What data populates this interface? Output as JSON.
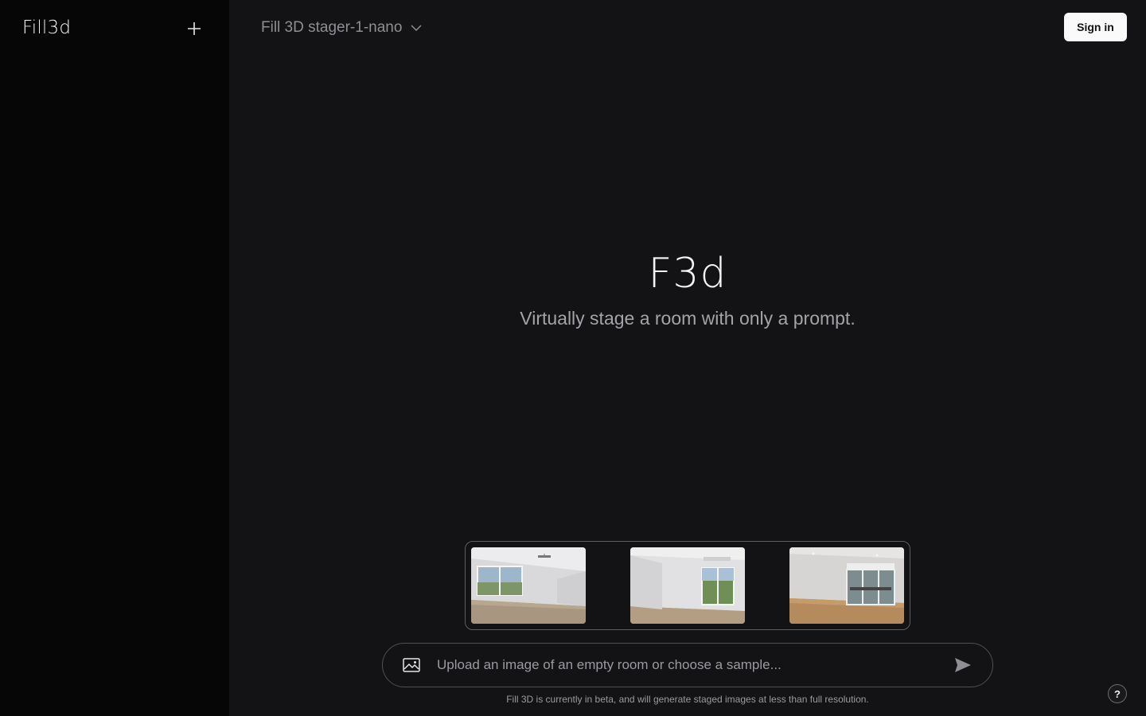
{
  "sidebar": {
    "logo_text": "Fill3d",
    "new_icon": "plus-icon"
  },
  "header": {
    "model_name": "Fill 3D stager-1-nano",
    "model_dropdown_icon": "chevron-down-icon",
    "signin_label": "Sign in"
  },
  "hero": {
    "logo_text": "F3d",
    "tagline": "Virtually stage a room with only a prompt."
  },
  "samples": [
    {
      "name": "sample-room-1",
      "description": "empty room with ceiling fan and window"
    },
    {
      "name": "sample-room-2",
      "description": "empty room with window"
    },
    {
      "name": "sample-room-3",
      "description": "empty room with balcony doors"
    }
  ],
  "composer": {
    "upload_icon": "image-icon",
    "placeholder": "Upload an image of an empty room or choose a sample...",
    "send_icon": "send-icon"
  },
  "footer": {
    "disclaimer": "Fill 3D is currently in beta, and will generate staged images at less than full resolution.",
    "help_label": "?"
  },
  "colors": {
    "background": "#131316",
    "sidebar": "#060607",
    "text_muted": "#a3a3a8",
    "button_bg": "#fafafa"
  }
}
